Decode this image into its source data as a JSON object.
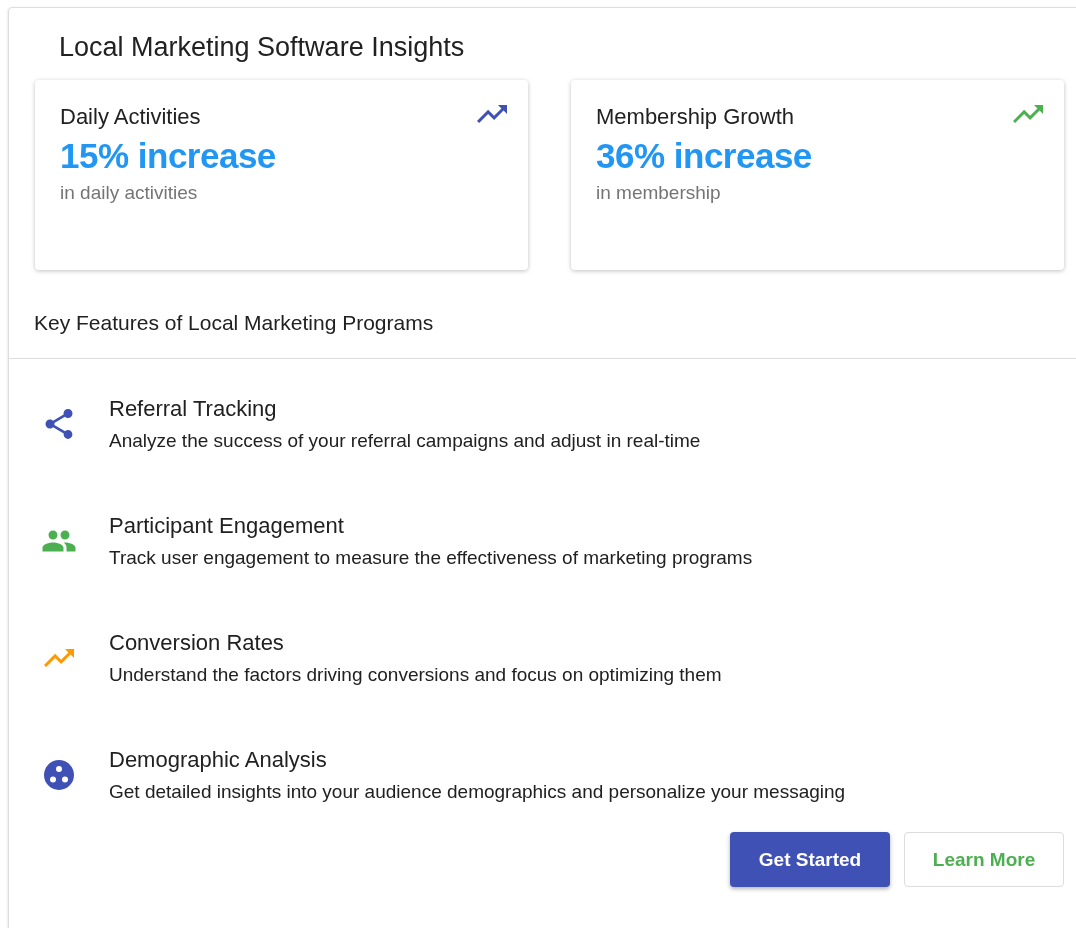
{
  "title": "Local Marketing Software Insights",
  "stats": [
    {
      "label": "Daily Activities",
      "value": "15% increase",
      "caption": "in daily activities",
      "color": "#3f51b5"
    },
    {
      "label": "Membership Growth",
      "value": "36% increase",
      "caption": "in membership",
      "color": "#4caf50"
    }
  ],
  "features_heading": "Key Features of Local Marketing Programs",
  "features": [
    {
      "kind": "share",
      "color": "#3f51b5",
      "title": "Referral Tracking",
      "description": "Analyze the success of your referral campaigns and adjust in real-time"
    },
    {
      "kind": "people",
      "color": "#4caf50",
      "title": "Participant Engagement",
      "description": "Track user engagement to measure the effectiveness of marketing programs"
    },
    {
      "kind": "trend",
      "color": "#ff9800",
      "title": "Conversion Rates",
      "description": "Understand the factors driving conversions and focus on optimizing them"
    },
    {
      "kind": "bubbles",
      "color": "#3f51b5",
      "title": "Demographic Analysis",
      "description": "Get detailed insights into your audience demographics and personalize your messaging"
    }
  ],
  "buttons": [
    {
      "kind": "primary",
      "label": "Get Started"
    },
    {
      "kind": "outlined",
      "label": "Learn More"
    }
  ]
}
